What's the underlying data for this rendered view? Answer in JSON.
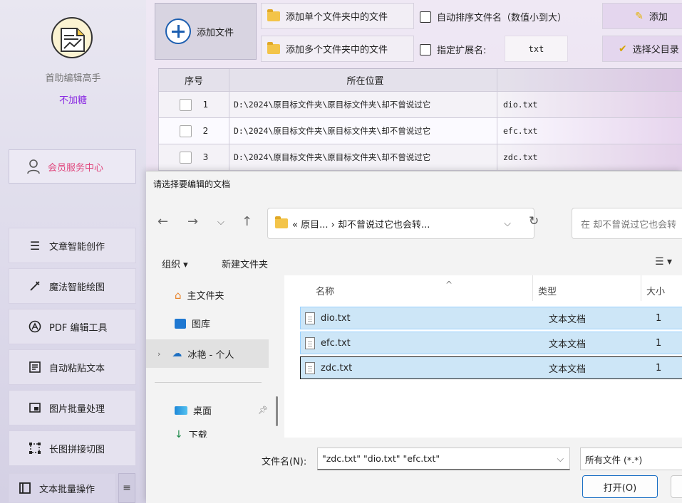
{
  "app": {
    "name": "首助编辑高手",
    "subtitle": "不加糖",
    "member_center": "会员服务中心"
  },
  "sidebar": {
    "items": [
      {
        "label": "文章智能创作",
        "icon": "list-icon"
      },
      {
        "label": "魔法智能绘图",
        "icon": "magic-wand-icon"
      },
      {
        "label": "PDF 编辑工具",
        "icon": "pdf-icon"
      },
      {
        "label": "自动粘贴文本",
        "icon": "paste-icon"
      },
      {
        "label": "图片批量处理",
        "icon": "image-icon"
      },
      {
        "label": "长图拼接切图",
        "icon": "crop-icon"
      },
      {
        "label": "文本批量操作",
        "icon": "text-batch-icon"
      }
    ]
  },
  "toolbar": {
    "add_file": "添加文件",
    "add_single_folder": "添加单个文件夹中的文件",
    "add_multi_folder": "添加多个文件夹中的文件",
    "auto_sort": "自动排序文件名（数值小到大）",
    "specify_ext": "指定扩展名:",
    "ext_value": "txt",
    "add_partial": "添加",
    "choose_parent": "选择父目录"
  },
  "table": {
    "headers": {
      "index": "序号",
      "location": "所在位置"
    },
    "rows": [
      {
        "index": "1",
        "location": "D:\\2024\\原目标文件夹\\原目标文件夹\\却不曾说过它",
        "name": "dio.txt"
      },
      {
        "index": "2",
        "location": "D:\\2024\\原目标文件夹\\原目标文件夹\\却不曾说过它",
        "name": "efc.txt"
      },
      {
        "index": "3",
        "location": "D:\\2024\\原目标文件夹\\原目标文件夹\\却不曾说过它",
        "name": "zdc.txt"
      }
    ]
  },
  "dialog": {
    "title": "请选择要编辑的文档",
    "address": "« 原目... › 却不曾说过它也会转...",
    "search_placeholder": "在 却不曾说过它也会转",
    "organize": "组织 ▾",
    "new_folder": "新建文件夹",
    "nav": {
      "home": "主文件夹",
      "gallery": "图库",
      "cloud": "冰艳 - 个人",
      "desktop": "桌面",
      "downloads": "下载"
    },
    "columns": {
      "name": "名称",
      "type": "类型",
      "size": "大小"
    },
    "files": [
      {
        "name": "dio.txt",
        "type": "文本文档",
        "size": "1"
      },
      {
        "name": "efc.txt",
        "type": "文本文档",
        "size": "1"
      },
      {
        "name": "zdc.txt",
        "type": "文本文档",
        "size": "1"
      }
    ],
    "filename_label": "文件名(N):",
    "filename_value": "\"zdc.txt\" \"dio.txt\" \"efc.txt\"",
    "filter": "所有文件 (*.*)",
    "open_button": "打开(O)"
  }
}
